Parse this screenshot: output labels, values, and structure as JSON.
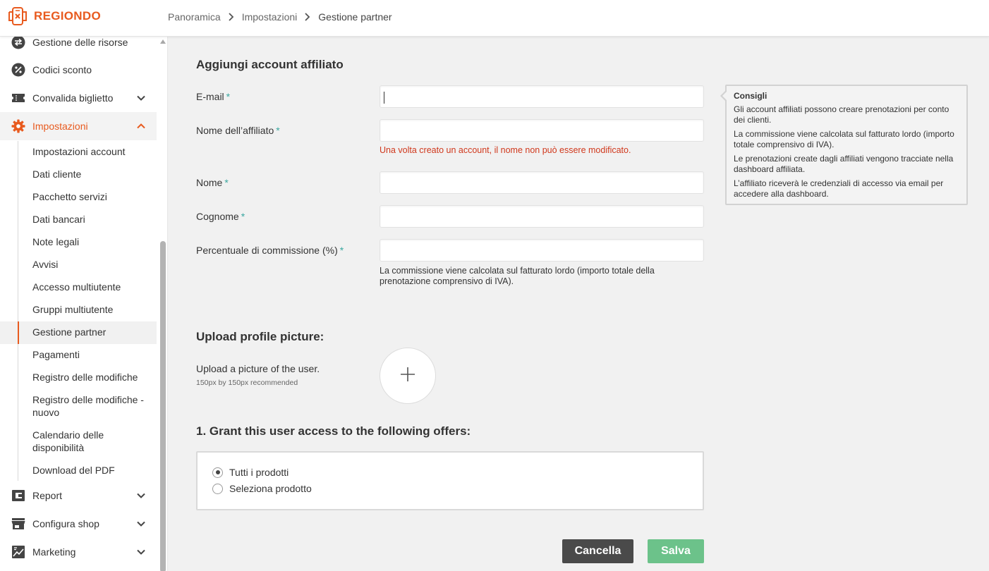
{
  "app": {
    "brand": "REGIONDO"
  },
  "breadcrumb": {
    "items": [
      "Panoramica",
      "Impostazioni",
      "Gestione partner"
    ]
  },
  "sidebar": {
    "items": [
      {
        "label": "Gestione delle risorse",
        "icon": "swap-icon"
      },
      {
        "label": "Codici sconto",
        "icon": "percent-icon"
      },
      {
        "label": "Convalida biglietto",
        "icon": "ticket-icon",
        "expandable": true
      },
      {
        "label": "Impostazioni",
        "icon": "gear-icon",
        "expanded": true,
        "active": true
      },
      {
        "label": "Report",
        "icon": "wallet-icon",
        "expandable": true
      },
      {
        "label": "Configura shop",
        "icon": "store-icon",
        "expandable": true
      },
      {
        "label": "Marketing",
        "icon": "chart-icon",
        "expandable": true
      }
    ],
    "subitems": [
      "Impostazioni account",
      "Dati cliente",
      "Pacchetto servizi",
      "Dati bancari",
      "Note legali",
      "Avvisi",
      "Accesso multiutente",
      "Gruppi multiutente",
      "Gestione partner",
      "Pagamenti",
      "Registro delle modifiche",
      "Registro delle modifiche - nuovo",
      "Calendario delle disponibilità",
      "Download del PDF"
    ],
    "selected_subitem": "Gestione partner"
  },
  "form": {
    "title": "Aggiungi account affiliato",
    "required_mark": "*",
    "fields": {
      "email": {
        "label": "E-mail",
        "value": ""
      },
      "affiliate_name": {
        "label": "Nome dell’affiliato",
        "value": "",
        "error": "Una volta creato un account, il nome non può essere modificato."
      },
      "first_name": {
        "label": "Nome",
        "value": ""
      },
      "last_name": {
        "label": "Cognome",
        "value": ""
      },
      "commission": {
        "label": "Percentuale di commissione (%)",
        "value": "",
        "help": "La commissione viene calcolata sul fatturato lordo (importo totale della prenotazione comprensivo di IVA)."
      }
    },
    "tips": {
      "title": "Consigli",
      "lines": [
        "Gli account affiliati possono creare prenotazioni per conto dei clienti.",
        "La commissione viene calcolata sul fatturato lordo (importo totale comprensivo di IVA).",
        "Le prenotazioni create dagli affiliati vengono tracciate nella dashboard affiliata.",
        "L’affiliato riceverà le credenziali di accesso via email per accedere alla dashboard."
      ]
    },
    "upload": {
      "title": "Upload profile picture:",
      "label": "Upload a picture of the user.",
      "hint": "150px by 150px recommended",
      "button_icon": "plus-icon"
    },
    "offers": {
      "title": "1. Grant this user access to the following offers:",
      "options": [
        "Tutti i prodotti",
        "Seleziona prodotto"
      ],
      "selected": "Tutti i prodotti"
    },
    "actions": {
      "cancel": "Cancella",
      "save": "Salva"
    }
  },
  "colors": {
    "brand": "#e85a1e",
    "required": "#3aa7a0",
    "error": "#d0381c",
    "save": "#6cc28a",
    "cancel": "#4a4a4a"
  }
}
